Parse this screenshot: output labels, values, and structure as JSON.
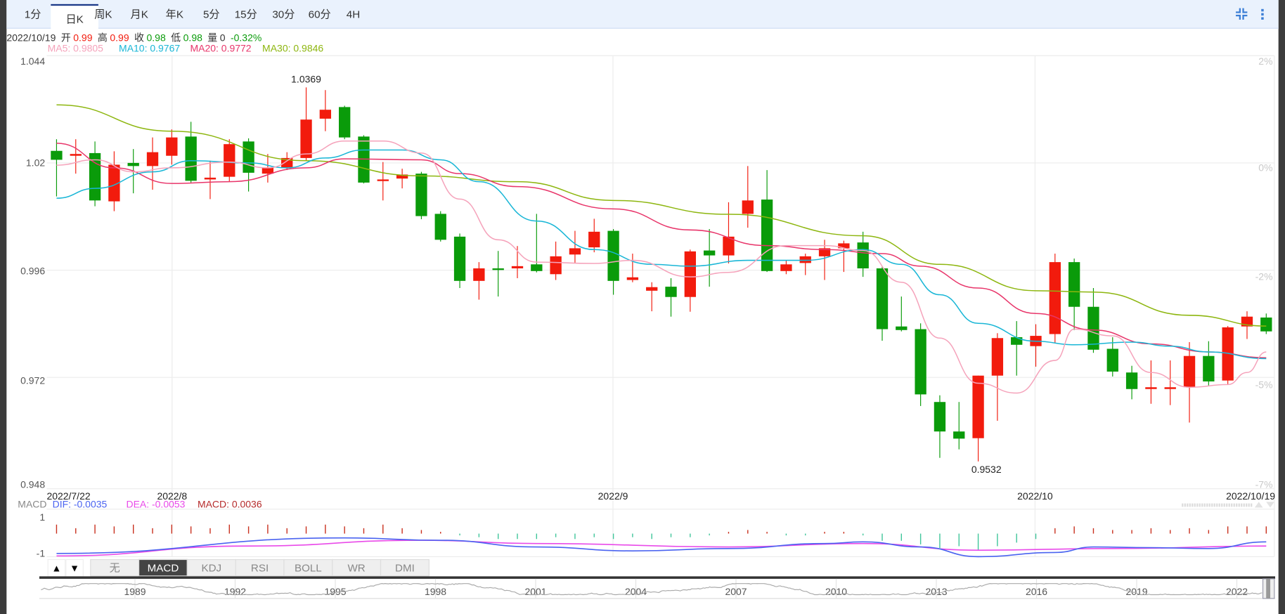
{
  "tabs": [
    "1分",
    "日K",
    "周K",
    "月K",
    "年K",
    "5分",
    "15分",
    "30分",
    "60分",
    "4H"
  ],
  "active_tab": "日K",
  "toolbar_icons": [
    "compress-icon",
    "more-vertical-icon"
  ],
  "info": {
    "date": "2022/10/19",
    "open_label": "开",
    "open": "0.99",
    "high_label": "高",
    "high": "0.99",
    "close_label": "收",
    "close": "0.98",
    "low_label": "低",
    "low": "0.98",
    "volume_label": "量",
    "volume": "0",
    "change": "-0.32%"
  },
  "ma_legend": {
    "ma5": "MA5: 0.9805",
    "ma10": "MA10: 0.9767",
    "ma20": "MA20: 0.9772",
    "ma30": "MA30: 0.9846"
  },
  "colors": {
    "up": "#f21b0d",
    "down": "#0a9b0a",
    "ma5": "#f5a3bb",
    "ma10": "#19b6d6",
    "ma20": "#e8356a",
    "ma30": "#8db60f",
    "dif": "#4a63f0",
    "dea": "#e94ae9",
    "macd": "#b52a2a"
  },
  "macd_legend": {
    "label": "MACD",
    "dif": "DIF: -0.0035",
    "dea": "DEA: -0.0053",
    "macd": "MACD: 0.0036"
  },
  "indicator_tabs": [
    "无",
    "MACD",
    "KDJ",
    "RSI",
    "BOLL",
    "WR",
    "DMI"
  ],
  "active_indicator": "MACD",
  "scroll_buttons": [
    "▲",
    "▼"
  ],
  "chart_data": {
    "type": "candlestick",
    "yticks": [
      "1.044",
      "1.02",
      "0.996",
      "0.972",
      "0.948"
    ],
    "ylim": [
      0.948,
      1.044
    ],
    "pct_ticks": [
      "2%",
      "0%",
      "-2%",
      "-5%",
      "-7%"
    ],
    "xticks": [
      {
        "label": "2022/7/22",
        "index": 0
      },
      {
        "label": "2022/8",
        "index": 6
      },
      {
        "label": "2022/9",
        "index": 29
      },
      {
        "label": "2022/10",
        "index": 51
      },
      {
        "label": "2022/10/19",
        "index": 63
      }
    ],
    "max_label": {
      "text": "1.0369",
      "index": 13,
      "value": 1.0369
    },
    "min_label": {
      "text": "0.9532",
      "index": 48,
      "value": 0.9532
    },
    "ohlc": [
      [
        1.0227,
        1.0253,
        1.0125,
        1.0207
      ],
      [
        1.0216,
        1.0253,
        1.0176,
        1.022
      ],
      [
        1.0222,
        1.0248,
        1.0103,
        1.0116
      ],
      [
        1.0114,
        1.0226,
        1.0092,
        1.0196
      ],
      [
        1.02,
        1.0231,
        1.0132,
        1.0193
      ],
      [
        1.0193,
        1.0257,
        1.014,
        1.0224
      ],
      [
        1.0216,
        1.0275,
        1.0196,
        1.0257
      ],
      [
        1.0259,
        1.0292,
        1.0156,
        1.016
      ],
      [
        1.0163,
        1.0205,
        1.0119,
        1.0167
      ],
      [
        1.0169,
        1.0253,
        1.0158,
        1.0242
      ],
      [
        1.0248,
        1.0255,
        1.0136,
        1.0178
      ],
      [
        1.0176,
        1.022,
        1.0156,
        1.0189
      ],
      [
        1.0189,
        1.0224,
        1.0184,
        1.0211
      ],
      [
        1.0211,
        1.0369,
        1.0205,
        1.0297
      ],
      [
        1.0299,
        1.0363,
        1.0271,
        1.0319
      ],
      [
        1.0325,
        1.0328,
        1.0253,
        1.0257
      ],
      [
        1.0259,
        1.0262,
        1.0154,
        1.0156
      ],
      [
        1.016,
        1.0202,
        1.0116,
        1.0163
      ],
      [
        1.0165,
        1.0187,
        1.0143,
        1.0174
      ],
      [
        1.0176,
        1.018,
        1.0074,
        1.0081
      ],
      [
        1.0086,
        1.0092,
        1.0024,
        1.0028
      ],
      [
        1.0035,
        1.0042,
        0.992,
        0.9936
      ],
      [
        0.9936,
        0.9978,
        0.9894,
        0.9964
      ],
      [
        0.9964,
        1.0003,
        0.9901,
        0.9962
      ],
      [
        0.9964,
        1.0014,
        0.9942,
        0.9969
      ],
      [
        0.9973,
        1.0086,
        0.9955,
        0.9958
      ],
      [
        0.9951,
        1.0024,
        0.9938,
        0.9991
      ],
      [
        0.9995,
        1.0048,
        0.9975,
        1.0009
      ],
      [
        1.0011,
        1.0075,
        1.0,
        1.0046
      ],
      [
        1.0048,
        1.0052,
        0.9905,
        0.9936
      ],
      [
        0.9938,
        0.9997,
        0.9933,
        0.9944
      ],
      [
        0.9914,
        0.9933,
        0.9868,
        0.9922
      ],
      [
        0.9923,
        0.9942,
        0.9856,
        0.99
      ],
      [
        0.99,
        1.0006,
        0.9867,
        1.0002
      ],
      [
        1.0004,
        1.0052,
        0.9923,
        0.9993
      ],
      [
        0.9993,
        1.0112,
        0.9975,
        1.0035
      ],
      [
        1.0086,
        1.0193,
        1.0055,
        1.0116
      ],
      [
        1.0118,
        1.0184,
        0.9956,
        0.9958
      ],
      [
        0.9958,
        0.9982,
        0.9951,
        0.9973
      ],
      [
        0.9976,
        0.9997,
        0.9949,
        0.9991
      ],
      [
        0.9991,
        1.0028,
        0.9938,
        1.0009
      ],
      [
        1.0009,
        1.0026,
        0.9956,
        1.002
      ],
      [
        1.0022,
        1.0046,
        0.9945,
        0.9964
      ],
      [
        0.9964,
        0.9969,
        0.9802,
        0.9828
      ],
      [
        0.9834,
        0.9901,
        0.9823,
        0.9826
      ],
      [
        0.9828,
        0.9841,
        0.9656,
        0.9682
      ],
      [
        0.9665,
        0.968,
        0.954,
        0.9599
      ],
      [
        0.9599,
        0.9665,
        0.9559,
        0.9583
      ],
      [
        0.9584,
        0.9724,
        0.9532,
        0.9724
      ],
      [
        0.9724,
        0.9819,
        0.9623,
        0.9808
      ],
      [
        0.981,
        0.9846,
        0.9724,
        0.9793
      ],
      [
        0.979,
        0.9839,
        0.9744,
        0.9813
      ],
      [
        0.9817,
        0.9997,
        0.9797,
        0.9978
      ],
      [
        0.9978,
        0.9986,
        0.9826,
        0.9878
      ],
      [
        0.9878,
        0.992,
        0.9775,
        0.9782
      ],
      [
        0.9784,
        0.981,
        0.9722,
        0.9733
      ],
      [
        0.9731,
        0.9746,
        0.9671,
        0.9694
      ],
      [
        0.9694,
        0.9758,
        0.9661,
        0.9698
      ],
      [
        0.9694,
        0.9758,
        0.9658,
        0.9698
      ],
      [
        0.9698,
        0.9799,
        0.9619,
        0.9768
      ],
      [
        0.9768,
        0.9801,
        0.9702,
        0.9711
      ],
      [
        0.9713,
        0.9835,
        0.9705,
        0.9832
      ],
      [
        0.9834,
        0.9868,
        0.9806,
        0.9856
      ],
      [
        0.9854,
        0.9863,
        0.9817,
        0.9823
      ]
    ],
    "ma": {
      "ma30": [
        [
          0,
          1.033
        ],
        [
          6,
          1.0271
        ],
        [
          13,
          1.0205
        ],
        [
          19,
          1.0171
        ],
        [
          24,
          1.0158
        ],
        [
          29,
          1.0116
        ],
        [
          35,
          1.0085
        ],
        [
          42,
          1.0037
        ],
        [
          46,
          0.9973
        ],
        [
          51,
          0.9914
        ],
        [
          54,
          0.9911
        ],
        [
          59,
          0.9859
        ],
        [
          63,
          0.9835
        ]
      ],
      "ma20": [
        [
          0,
          1.0244
        ],
        [
          3,
          1.0189
        ],
        [
          6,
          1.0154
        ],
        [
          9,
          1.0158
        ],
        [
          13,
          1.0189
        ],
        [
          15,
          1.0209
        ],
        [
          19,
          1.0207
        ],
        [
          21,
          1.0176
        ],
        [
          24,
          1.0147
        ],
        [
          29,
          1.0097
        ],
        [
          33,
          1.005
        ],
        [
          37,
          1.0015
        ],
        [
          40,
          1.0006
        ],
        [
          43,
          0.9997
        ],
        [
          45,
          0.9969
        ],
        [
          48,
          0.992
        ],
        [
          51,
          0.9863
        ],
        [
          54,
          0.9826
        ],
        [
          57,
          0.9795
        ],
        [
          60,
          0.9777
        ],
        [
          63,
          0.9764
        ]
      ],
      "ma10": [
        [
          0,
          1.0121
        ],
        [
          2,
          1.0143
        ],
        [
          5,
          1.018
        ],
        [
          7,
          1.0205
        ],
        [
          10,
          1.02
        ],
        [
          12,
          1.0189
        ],
        [
          14,
          1.0211
        ],
        [
          16,
          1.0229
        ],
        [
          18,
          1.0229
        ],
        [
          20,
          1.0207
        ],
        [
          22,
          1.0158
        ],
        [
          25,
          1.007
        ],
        [
          28,
          1.0006
        ],
        [
          31,
          0.9973
        ],
        [
          33,
          0.9969
        ],
        [
          36,
          0.9982
        ],
        [
          39,
          0.9982
        ],
        [
          42,
          1.0006
        ],
        [
          44,
          0.9973
        ],
        [
          46,
          0.9905
        ],
        [
          48,
          0.9841
        ],
        [
          51,
          0.9801
        ],
        [
          53,
          0.9793
        ],
        [
          56,
          0.9799
        ],
        [
          58,
          0.979
        ],
        [
          60,
          0.9777
        ],
        [
          63,
          0.9762
        ]
      ],
      "ma5": [
        [
          0,
          1.0195
        ],
        [
          2,
          1.0207
        ],
        [
          4,
          1.018
        ],
        [
          6,
          1.0189
        ],
        [
          9,
          1.0202
        ],
        [
          11,
          1.0189
        ],
        [
          13,
          1.022
        ],
        [
          15,
          1.0249
        ],
        [
          17,
          1.0249
        ],
        [
          19,
          1.0222
        ],
        [
          21,
          1.0119
        ],
        [
          23,
          1.0028
        ],
        [
          25,
          0.9978
        ],
        [
          28,
          0.9975
        ],
        [
          30,
          0.9982
        ],
        [
          33,
          0.9945
        ],
        [
          35,
          0.9955
        ],
        [
          38,
          1.0015
        ],
        [
          40,
          1.0015
        ],
        [
          42,
          1.0004
        ],
        [
          44,
          0.9933
        ],
        [
          46,
          0.9808
        ],
        [
          48,
          0.9707
        ],
        [
          50,
          0.9685
        ],
        [
          52,
          0.9758
        ],
        [
          53,
          0.9828
        ],
        [
          55,
          0.9813
        ],
        [
          57,
          0.9731
        ],
        [
          59,
          0.9698
        ],
        [
          61,
          0.9704
        ],
        [
          62,
          0.9731
        ],
        [
          63,
          0.9777
        ]
      ]
    },
    "macd_pane": {
      "yticks": [
        "1",
        "-1"
      ],
      "ylim": [
        -1,
        1
      ],
      "dif": [
        [
          0,
          -1.0
        ],
        [
          15,
          -0.14
        ],
        [
          20,
          -0.27
        ],
        [
          25,
          -0.64
        ],
        [
          30,
          -0.86
        ],
        [
          35,
          -0.73
        ],
        [
          40,
          -0.45
        ],
        [
          42,
          -0.36
        ],
        [
          45,
          -0.64
        ],
        [
          48,
          -1.18
        ],
        [
          52,
          -0.95
        ],
        [
          54,
          -0.64
        ],
        [
          57,
          -0.68
        ],
        [
          60,
          -0.73
        ],
        [
          63,
          -0.36
        ]
      ],
      "dea": [
        [
          0,
          -1.14
        ],
        [
          10,
          -0.59
        ],
        [
          19,
          -0.27
        ],
        [
          25,
          -0.45
        ],
        [
          35,
          -0.64
        ],
        [
          42,
          -0.45
        ],
        [
          48,
          -0.82
        ],
        [
          55,
          -0.73
        ],
        [
          63,
          -0.59
        ]
      ],
      "histogram": [
        0.5,
        0.3,
        0.5,
        0.4,
        0.5,
        0.3,
        0.5,
        0.4,
        0.3,
        0.5,
        0.4,
        0.5,
        0.3,
        0.4,
        0.5,
        0.4,
        0.3,
        0.5,
        0.3,
        0.2,
        0.1,
        -0.1,
        -0.2,
        -0.3,
        -0.3,
        -0.3,
        -0.2,
        -0.3,
        -0.2,
        -0.3,
        -0.2,
        -0.3,
        -0.2,
        -0.2,
        -0.1,
        0.1,
        0.2,
        0.1,
        -0.1,
        -0.1,
        0.1,
        0.1,
        -0.1,
        -0.4,
        -0.4,
        -0.6,
        -0.8,
        -0.7,
        -0.9,
        -0.7,
        -0.5,
        -0.3,
        0.3,
        0.4,
        0.3,
        0.2,
        0.2,
        0.3,
        0.2,
        0.3,
        0.2,
        0.4,
        0.4,
        0.4
      ]
    },
    "navigator_years": [
      "1989",
      "1992",
      "1995",
      "1998",
      "2001",
      "2004",
      "2007",
      "2010",
      "2013",
      "2016",
      "2019",
      "2022"
    ]
  }
}
